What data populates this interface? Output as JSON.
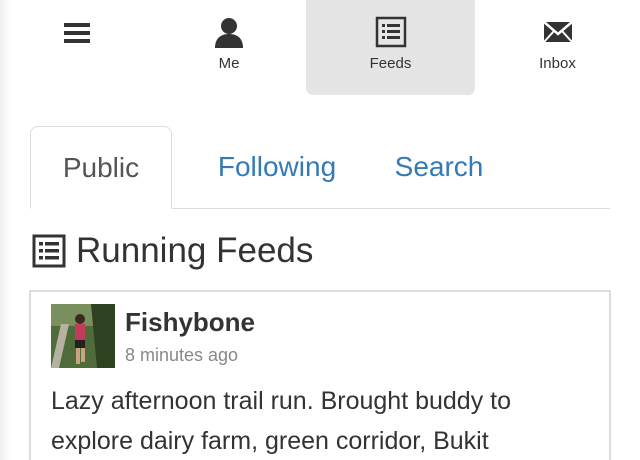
{
  "topnav": {
    "items": [
      {
        "id": "menu",
        "label": "",
        "icon": "menu-icon"
      },
      {
        "id": "me",
        "label": "Me",
        "icon": "user-icon"
      },
      {
        "id": "feeds",
        "label": "Feeds",
        "icon": "list-icon",
        "active": true
      },
      {
        "id": "inbox",
        "label": "Inbox",
        "icon": "envelope-icon"
      }
    ],
    "active_bg": "#e5e5e5"
  },
  "tabs": [
    {
      "label": "Public",
      "active": true
    },
    {
      "label": "Following",
      "active": false
    },
    {
      "label": "Search",
      "active": false
    }
  ],
  "heading": {
    "title": "Running Feeds",
    "icon": "list-icon"
  },
  "feed": {
    "user": "Fishybone",
    "time": "8 minutes ago",
    "text": "Lazy afternoon trail run. Brought buddy to explore dairy farm, green corridor, Bukit",
    "avatar_icon": "runner-photo"
  },
  "colors": {
    "link": "#337ab7",
    "text": "#333333",
    "muted": "#888888",
    "border": "#dddddd"
  }
}
